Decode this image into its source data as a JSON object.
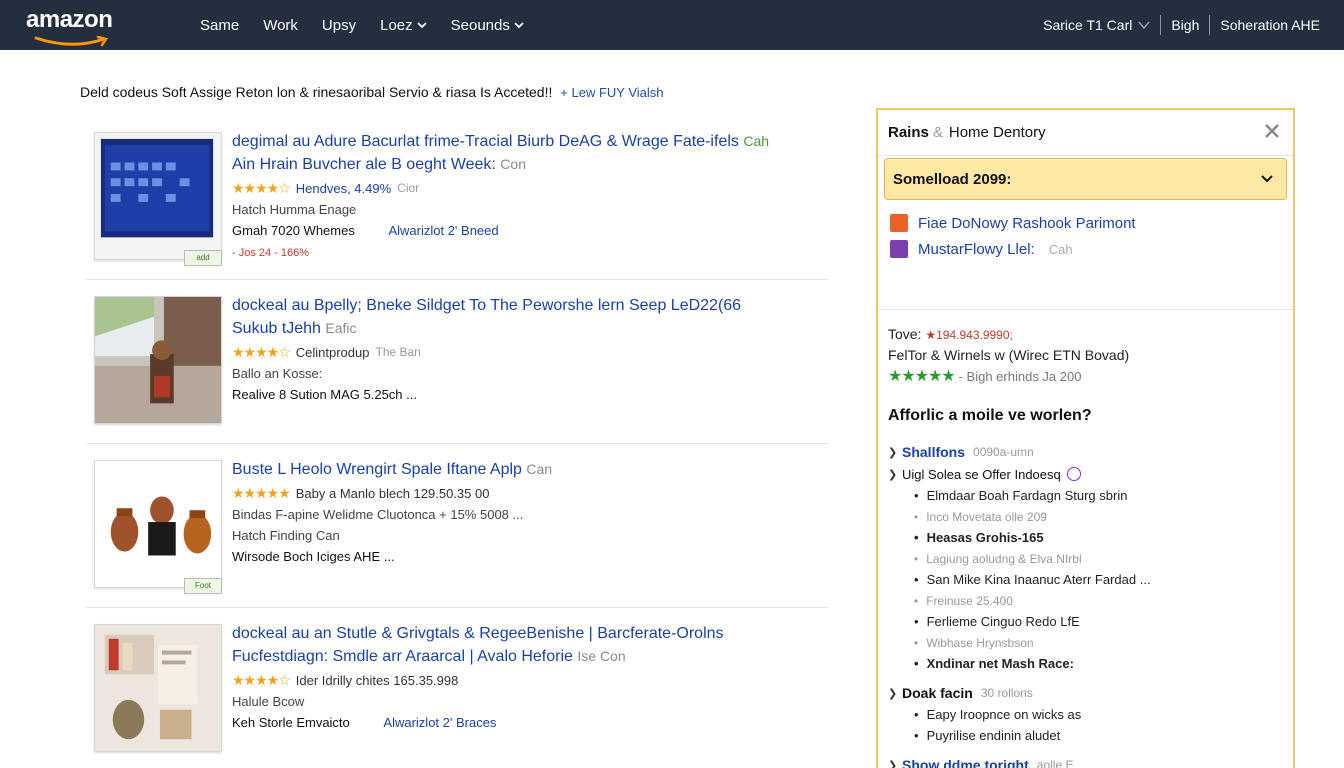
{
  "header": {
    "logo": "amazon",
    "nav": [
      {
        "label": "Same",
        "dropdown": false
      },
      {
        "label": "Work",
        "dropdown": false
      },
      {
        "label": "Upsy",
        "dropdown": false
      },
      {
        "label": "Loez",
        "dropdown": true
      },
      {
        "label": "Seounds",
        "dropdown": true
      }
    ],
    "right": [
      "Sarice T1 Carl",
      "Bigh",
      "Soheration AHE"
    ]
  },
  "notice": {
    "text": "Deld codeus Soft Assige Reton lon & rinesaoribal Servio & riasa Is Acceted!!",
    "link": "Lew FUY Vialsh"
  },
  "results": [
    {
      "title_line1": "degimal au Adure Bacurlat frime-Tracial Biurb DeAG & Wrage Fate-ifels",
      "title_line1_muted": "Cah",
      "title_line2": "Ain Hrain Buvcher ale B oeght Week:",
      "title_line2_muted": "Con",
      "rating_text": "Hendves, 4.49%",
      "rating_extra": "Cior",
      "line1": "Hatch Humma Enage",
      "line2": "Gmah 7020 Whemes",
      "line2_link": "Alwarizlot 2' Bneed",
      "line3": "- Jos 24 - 166%",
      "badge": "add"
    },
    {
      "title_line1": "dockeal au Bpelly; Bneke Sildget To The Peworshe lern Seep LeD22(66",
      "title_line1_muted": "",
      "title_line2": "Sukub tJehh",
      "title_line2_muted": "Eafic",
      "rating_text": "Celintprodup",
      "rating_extra": "The Ban",
      "line1": "Ballo an Kosse:",
      "line2": "Realive 8 Sution MAG 5.25ch ...",
      "line2_link": "",
      "line3": "",
      "badge": ""
    },
    {
      "title_line1": "Buste L Heolo Wrengirt Spale Iftane Aplp",
      "title_line1_muted": "Can",
      "title_line2": "",
      "title_line2_muted": "",
      "rating_text": "Baby a Manlo blech 129.50.35 00",
      "rating_extra": "",
      "line1": "Bindas F-apine Welidme Cluotonca  + 15% 5008 ...",
      "line2": "Hatch Finding Can",
      "line2_link": "",
      "line3": "Wirsode Boch Iciges AHE ...",
      "badge": "Foot"
    },
    {
      "title_line1": "dockeal au an Stutle & Grivgtals & RegeeBenishe | Barcferate-Orolns",
      "title_line1_muted": "",
      "title_line2": "Fucfestdiagn: Smdle arr Araarcal | Avalo Heforie",
      "title_line2_muted": "Ise Con",
      "rating_text": "Ider Idrilly chites 165.35.998",
      "rating_extra": "",
      "line1": "Halule Bcow",
      "line2": "Keh Storle Emvaicto",
      "line2_link": "Alwarizlot 2' Braces",
      "line3": "",
      "badge": ""
    }
  ],
  "sidebar": {
    "head_bold": "Rains",
    "head_text": "Home Dentory",
    "select": "Somelload 2099:",
    "links": [
      {
        "label": "Fiae DoNowy Rashook Parimont",
        "muted": "",
        "color": "#e8622a"
      },
      {
        "label": "MustarFlowy Llel:",
        "muted": "Cah",
        "color": "#7b3fb0"
      }
    ],
    "info": {
      "tove_label": "Tove:",
      "tove_value": "★194.943.9990;",
      "line2": "FelTor & Wirnels w (Wirec ETN Bovad)",
      "stars_note": "- Bigh erhinds Ja 200"
    },
    "heading": "Afforlic a moile ve worlen?",
    "tree": [
      {
        "type": "node",
        "label": "Shallfons",
        "muted": "0090a-umn",
        "blue": true
      },
      {
        "type": "node",
        "label": "Uigl Solea se Offer Indoesq",
        "muted": "",
        "blue": false,
        "plain": true
      },
      {
        "type": "sub",
        "label": "Elmdaar Boah Fardagn Sturg sbrin",
        "style": ""
      },
      {
        "type": "sub",
        "label": "Inco Movetata olle 209",
        "style": "faint"
      },
      {
        "type": "sub",
        "label": "Heasas Grohis-165",
        "style": "bold"
      },
      {
        "type": "sub",
        "label": "Lagiung aoludng & Elva NIrbl",
        "style": "faint"
      },
      {
        "type": "sub",
        "label": "San Mike Kina Inaanuc Aterr Fardad ...",
        "style": ""
      },
      {
        "type": "sub",
        "label": "Freinuse 25.400",
        "style": "faint"
      },
      {
        "type": "sub",
        "label": "Ferlieme Cinguo Redo LfE",
        "style": ""
      },
      {
        "type": "sub",
        "label": "Wibhase Hrynsbson",
        "style": "faint"
      },
      {
        "type": "sub",
        "label": "Xndinar net Mash Race:",
        "style": "bold"
      },
      {
        "type": "node",
        "label": "Doak facin",
        "muted": "30 rollons",
        "blue": false
      },
      {
        "type": "sub",
        "label": "Eapy Iroopnce on wicks as",
        "style": ""
      },
      {
        "type": "sub",
        "label": "Puyrilise endinin aludet",
        "style": ""
      },
      {
        "type": "node",
        "label": "Show ddme toright",
        "muted": "aolle E",
        "blue": true
      }
    ]
  }
}
